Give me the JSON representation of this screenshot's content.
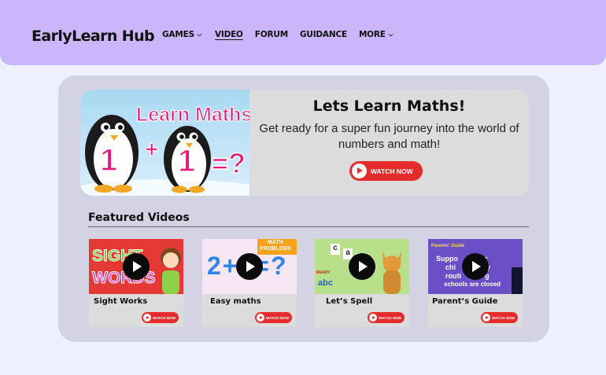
{
  "header": {
    "brand": "EarlyLearn Hub",
    "nav": [
      {
        "label": "GAMES",
        "dropdown": true
      },
      {
        "label": "VIDEO",
        "active": true
      },
      {
        "label": "FORUM"
      },
      {
        "label": "GUIDANCE"
      },
      {
        "label": "MORE",
        "dropdown": true
      }
    ]
  },
  "hero": {
    "thumbnail_text": {
      "headline": "Learn Maths",
      "digit_a": "1",
      "plus": "+",
      "digit_b": "1",
      "equals": "=?"
    },
    "title": "Lets Learn Maths!",
    "subtitle": "Get ready for a super fun journey into the world of numbers and math!",
    "watch_label": "WATCH NOW"
  },
  "featured": {
    "title": "Featured Videos",
    "cards": [
      {
        "label": "Sight Works",
        "watch_label": "WATCH NOW",
        "thumb_text": [
          "SIGHT",
          "WORDS"
        ],
        "thumb_color": "#e53935"
      },
      {
        "label": "Easy maths",
        "watch_label": "WATCH NOW",
        "thumb_text": [
          "MATH",
          "PROBLEMS",
          "2+5=?"
        ],
        "thumb_color": "#f7e6f3"
      },
      {
        "label": "Let’s Spell",
        "watch_label": "WATCH NOW",
        "thumb_text": [
          "c",
          "a",
          "t",
          "abc",
          "READY"
        ],
        "thumb_color": "#b8e08a"
      },
      {
        "label": "Parent’s Guide",
        "watch_label": "WATCH NOW",
        "thumb_text": [
          "Parents' Guide",
          "Suppo",
          "r",
          "chi",
          "y",
          "routi",
          "g",
          "schools are closed"
        ],
        "thumb_color": "#6a4fc6"
      }
    ]
  },
  "colors": {
    "header_bg": "#cbb6fb",
    "page_bg": "#eef0ff",
    "panel_bg": "#d4d3e3",
    "accent_red": "#e62b2b"
  }
}
